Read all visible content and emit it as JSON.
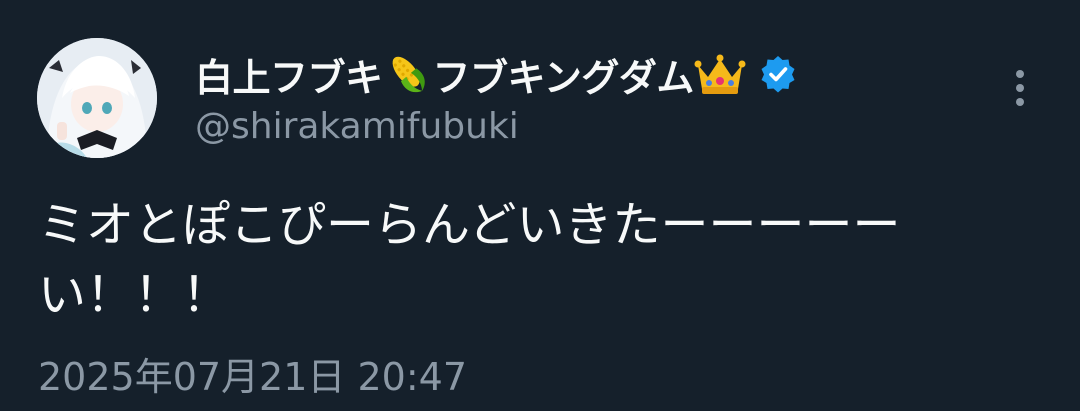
{
  "tweet": {
    "display_name_prefix": "白上フブキ",
    "display_name_middle": "フブキングダム",
    "name_emojis": [
      "corn-icon",
      "crown-icon"
    ],
    "handle": "@shirakamifubuki",
    "verified": true,
    "text_line1": "ミオとぽこぴーらんどいきたーーーーー",
    "text_line2": "い！！！",
    "timestamp": "2025年07月21日 20:47"
  },
  "colors": {
    "background": "#15202b",
    "text": "#f7f9f9",
    "secondary": "#8b98a5",
    "verified": "#1d9bf0"
  }
}
